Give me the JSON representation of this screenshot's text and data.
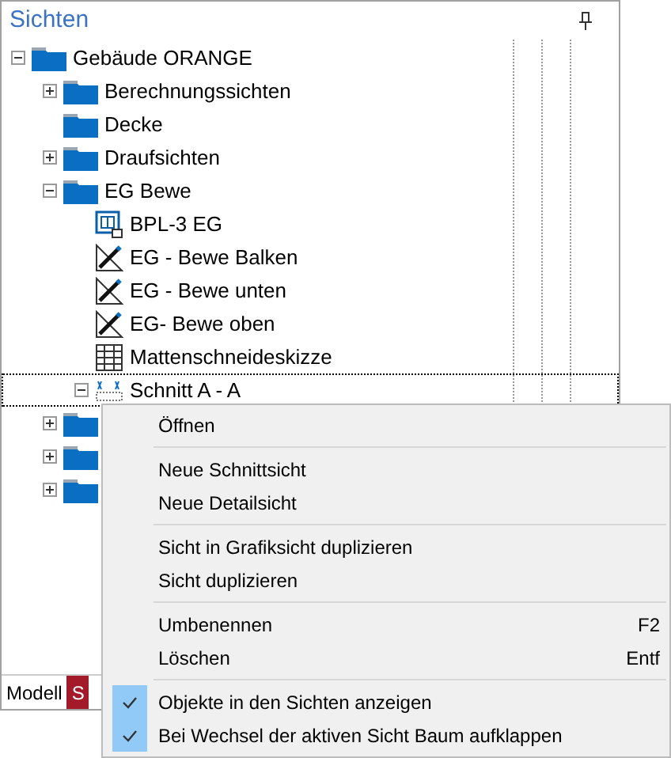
{
  "panel": {
    "title": "Sichten"
  },
  "tree": [
    {
      "label": "Gebäude ORANGE",
      "kind": "folder",
      "expanded": true,
      "selected": false,
      "children": [
        {
          "label": "Berechnungssichten",
          "kind": "folder",
          "expanded": false,
          "selected": false
        },
        {
          "label": "Decke",
          "kind": "folder",
          "selected": false
        },
        {
          "label": "Draufsichten",
          "kind": "folder",
          "expanded": false,
          "selected": false
        },
        {
          "label": "EG Bewe",
          "kind": "folder",
          "expanded": true,
          "selected": false,
          "children": [
            {
              "label": "BPL-3 EG",
              "kind": "plan",
              "selected": false
            },
            {
              "label": "EG - Bewe Balken",
              "kind": "sketch",
              "selected": false
            },
            {
              "label": "EG - Bewe unten",
              "kind": "sketch",
              "selected": false
            },
            {
              "label": "EG- Bewe oben",
              "kind": "sketch",
              "selected": false
            },
            {
              "label": "Mattenschneideskizze",
              "kind": "table",
              "selected": false
            },
            {
              "label": "Schnitt A - A",
              "kind": "section",
              "expanded": true,
              "selected": true
            }
          ]
        },
        {
          "kind": "folder",
          "expanded": false,
          "selected": false
        },
        {
          "kind": "folder",
          "expanded": false,
          "selected": false
        },
        {
          "kind": "folder",
          "expanded": false,
          "selected": false
        }
      ]
    }
  ],
  "tabs": [
    {
      "label": "Modell",
      "selected": false
    },
    {
      "label": "S",
      "selected": true
    }
  ],
  "context_menu": [
    {
      "kind": "item",
      "label": "Öffnen",
      "checked": false
    },
    {
      "kind": "separator"
    },
    {
      "kind": "item",
      "label": "Neue Schnittsicht",
      "checked": false
    },
    {
      "kind": "item",
      "label": "Neue Detailsicht",
      "checked": false
    },
    {
      "kind": "separator"
    },
    {
      "kind": "item",
      "label": "Sicht in Grafiksicht duplizieren",
      "checked": false
    },
    {
      "kind": "item",
      "label": "Sicht duplizieren",
      "checked": false
    },
    {
      "kind": "separator"
    },
    {
      "kind": "item",
      "label": "Umbenennen",
      "shortcut": "F2",
      "checked": false
    },
    {
      "kind": "item",
      "label": "Löschen",
      "shortcut": "Entf",
      "checked": false
    },
    {
      "kind": "separator"
    },
    {
      "kind": "item",
      "label": "Objekte in den Sichten anzeigen",
      "checked": true
    },
    {
      "kind": "item",
      "label": "Bei Wechsel der aktiven Sicht Baum aufklappen",
      "checked": true
    }
  ]
}
